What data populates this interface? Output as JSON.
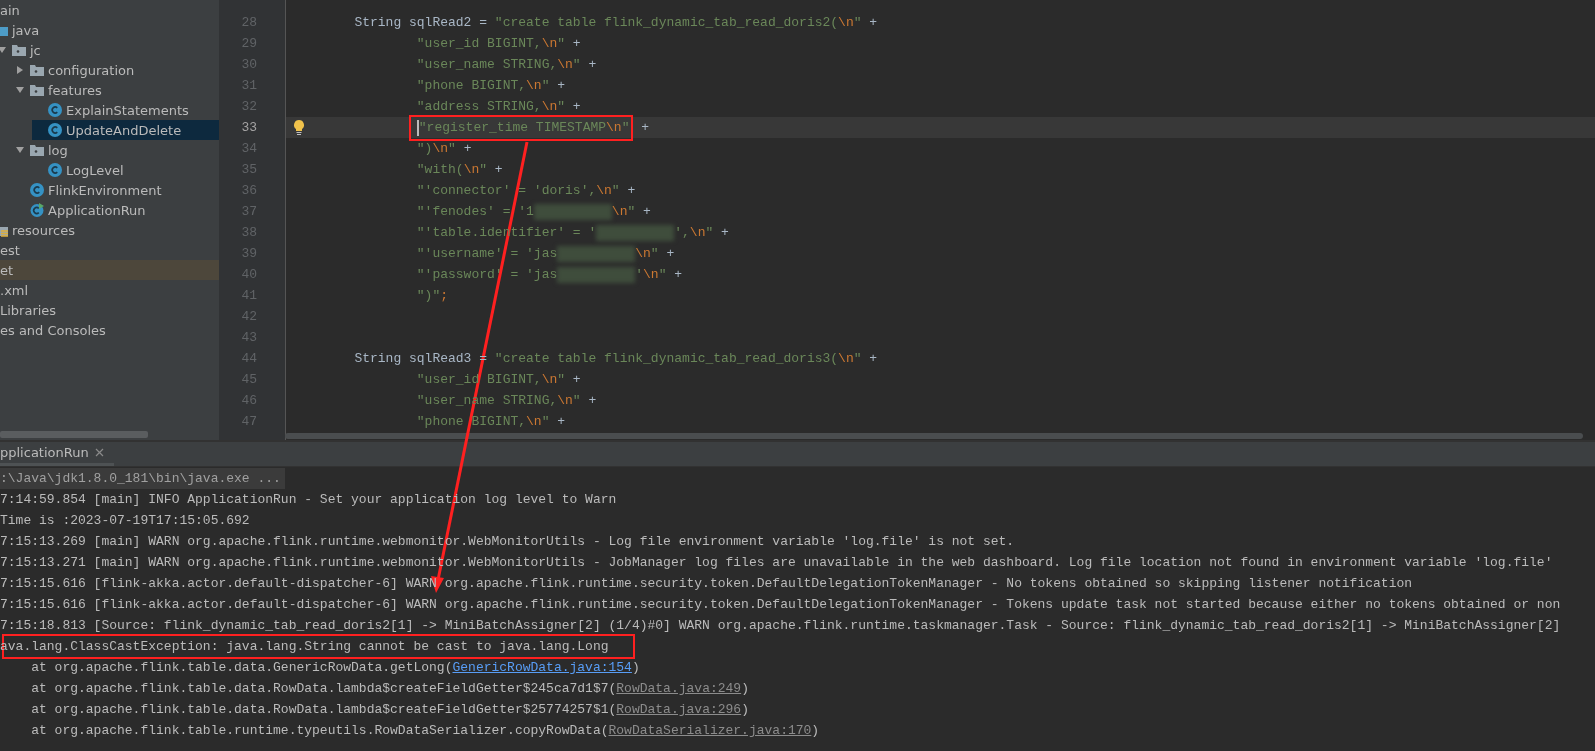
{
  "project_tree": {
    "items": [
      {
        "label": "ain",
        "children": [
          {
            "label": "java",
            "kind": "source-folder",
            "children": [
              {
                "label": "jc",
                "kind": "package",
                "expanded": true,
                "children": [
                  {
                    "label": "configuration",
                    "kind": "package",
                    "expanded": false
                  },
                  {
                    "label": "features",
                    "kind": "package",
                    "expanded": true,
                    "children": [
                      {
                        "label": "ExplainStatements",
                        "kind": "class",
                        "selected": false
                      },
                      {
                        "label": "UpdateAndDelete",
                        "kind": "class",
                        "selected": true
                      }
                    ]
                  },
                  {
                    "label": "log",
                    "kind": "package",
                    "expanded": true,
                    "children": [
                      {
                        "label": "LogLevel",
                        "kind": "class",
                        "selected": false
                      }
                    ]
                  },
                  {
                    "label": "FlinkEnvironment",
                    "kind": "class",
                    "selected": false
                  },
                  {
                    "label": "ApplicationRun",
                    "kind": "main-class",
                    "selected": false
                  }
                ]
              }
            ]
          },
          {
            "label": "resources",
            "kind": "resources-folder"
          }
        ]
      },
      {
        "label": "est"
      },
      {
        "label": "et",
        "excluded": true
      },
      {
        "label": ".xml"
      },
      {
        "label": "Libraries"
      },
      {
        "label": "es and Consoles"
      }
    ]
  },
  "editor": {
    "lines": [
      {
        "number": "28",
        "kind": "statement",
        "tokens": [
          {
            "kind": "plain",
            "text": "String sqlRead2 = "
          },
          {
            "kind": "str",
            "text": "\"create table flink_dynamic_tab_read_doris2("
          },
          {
            "kind": "esc",
            "text": "\\n"
          },
          {
            "kind": "str",
            "text": "\""
          },
          {
            "kind": "plain",
            "text": " +"
          }
        ]
      },
      {
        "number": "29",
        "kind": "continuation",
        "tokens": [
          {
            "kind": "str",
            "text": "\"user_id BIGINT,"
          },
          {
            "kind": "esc",
            "text": "\\n"
          },
          {
            "kind": "str",
            "text": "\""
          },
          {
            "kind": "plain",
            "text": " +"
          }
        ]
      },
      {
        "number": "30",
        "kind": "continuation",
        "tokens": [
          {
            "kind": "str",
            "text": "\"user_name STRING,"
          },
          {
            "kind": "esc",
            "text": "\\n"
          },
          {
            "kind": "str",
            "text": "\""
          },
          {
            "kind": "plain",
            "text": " +"
          }
        ]
      },
      {
        "number": "31",
        "kind": "continuation",
        "tokens": [
          {
            "kind": "str",
            "text": "\"phone BIGINT,"
          },
          {
            "kind": "esc",
            "text": "\\n"
          },
          {
            "kind": "str",
            "text": "\""
          },
          {
            "kind": "plain",
            "text": " +"
          }
        ]
      },
      {
        "number": "32",
        "kind": "continuation",
        "tokens": [
          {
            "kind": "str",
            "text": "\"address STRING,"
          },
          {
            "kind": "esc",
            "text": "\\n"
          },
          {
            "kind": "str",
            "text": "\""
          },
          {
            "kind": "plain",
            "text": " +"
          }
        ]
      },
      {
        "number": "33",
        "kind": "continuation",
        "current": true,
        "bulb": true,
        "caret": true,
        "tokens": [
          {
            "kind": "str",
            "text": "\"register_time TIMESTAMP",
            "boxed": true
          },
          {
            "kind": "esc",
            "text": "\\n",
            "boxed": true
          },
          {
            "kind": "str",
            "text": "\"",
            "boxed": true
          },
          {
            "kind": "plain",
            "text": " +"
          }
        ]
      },
      {
        "number": "34",
        "kind": "continuation",
        "tokens": [
          {
            "kind": "str",
            "text": "\")"
          },
          {
            "kind": "esc",
            "text": "\\n"
          },
          {
            "kind": "str",
            "text": "\""
          },
          {
            "kind": "plain",
            "text": " +"
          }
        ]
      },
      {
        "number": "35",
        "kind": "continuation",
        "tokens": [
          {
            "kind": "str",
            "text": "\"with("
          },
          {
            "kind": "esc",
            "text": "\\n"
          },
          {
            "kind": "str",
            "text": "\""
          },
          {
            "kind": "plain",
            "text": " +"
          }
        ]
      },
      {
        "number": "36",
        "kind": "continuation",
        "tokens": [
          {
            "kind": "str",
            "text": "\"'connector' = 'doris',"
          },
          {
            "kind": "esc",
            "text": "\\n"
          },
          {
            "kind": "str",
            "text": "\""
          },
          {
            "kind": "plain",
            "text": " +"
          }
        ]
      },
      {
        "number": "37",
        "kind": "continuation",
        "tokens": [
          {
            "kind": "str",
            "text": "\"'fenodes' = '1"
          },
          {
            "kind": "blur"
          },
          {
            "kind": "esc",
            "text": "\\n"
          },
          {
            "kind": "str",
            "text": "\""
          },
          {
            "kind": "plain",
            "text": " +"
          }
        ]
      },
      {
        "number": "38",
        "kind": "continuation",
        "tokens": [
          {
            "kind": "str",
            "text": "\"'table.identifier' = '"
          },
          {
            "kind": "blur"
          },
          {
            "kind": "str",
            "text": "',"
          },
          {
            "kind": "esc",
            "text": "\\n"
          },
          {
            "kind": "str",
            "text": "\""
          },
          {
            "kind": "plain",
            "text": " +"
          }
        ]
      },
      {
        "number": "39",
        "kind": "continuation",
        "tokens": [
          {
            "kind": "str",
            "text": "\"'username' = 'jas"
          },
          {
            "kind": "blur"
          },
          {
            "kind": "esc",
            "text": "\\n"
          },
          {
            "kind": "str",
            "text": "\""
          },
          {
            "kind": "plain",
            "text": " +"
          }
        ]
      },
      {
        "number": "40",
        "kind": "continuation",
        "tokens": [
          {
            "kind": "str",
            "text": "\"'password' = 'jas"
          },
          {
            "kind": "blur"
          },
          {
            "kind": "str",
            "text": "'"
          },
          {
            "kind": "esc",
            "text": "\\n"
          },
          {
            "kind": "str",
            "text": "\""
          },
          {
            "kind": "plain",
            "text": " +"
          }
        ]
      },
      {
        "number": "41",
        "kind": "continuation",
        "tokens": [
          {
            "kind": "str",
            "text": "\")\""
          },
          {
            "kind": "esc",
            "text": ";"
          }
        ]
      },
      {
        "number": "42"
      },
      {
        "number": "43"
      },
      {
        "number": "44",
        "kind": "statement",
        "tokens": [
          {
            "kind": "plain",
            "text": "String sqlRead3 = "
          },
          {
            "kind": "str",
            "text": "\"create table flink_dynamic_tab_read_doris3("
          },
          {
            "kind": "esc",
            "text": "\\n"
          },
          {
            "kind": "str",
            "text": "\""
          },
          {
            "kind": "plain",
            "text": " +"
          }
        ]
      },
      {
        "number": "45",
        "kind": "continuation",
        "tokens": [
          {
            "kind": "str",
            "text": "\"user_id BIGINT,"
          },
          {
            "kind": "esc",
            "text": "\\n"
          },
          {
            "kind": "str",
            "text": "\""
          },
          {
            "kind": "plain",
            "text": " +"
          }
        ]
      },
      {
        "number": "46",
        "kind": "continuation",
        "tokens": [
          {
            "kind": "str",
            "text": "\"user_name STRING,"
          },
          {
            "kind": "esc",
            "text": "\\n"
          },
          {
            "kind": "str",
            "text": "\""
          },
          {
            "kind": "plain",
            "text": " +"
          }
        ]
      },
      {
        "number": "47",
        "kind": "continuation",
        "tokens": [
          {
            "kind": "str",
            "text": "\"phone BIGINT,"
          },
          {
            "kind": "esc",
            "text": "\\n"
          },
          {
            "kind": "str",
            "text": "\""
          },
          {
            "kind": "plain",
            "text": " +"
          }
        ]
      }
    ]
  },
  "run_panel": {
    "tabs": [
      {
        "label": "pplicationRun",
        "selected": true
      }
    ],
    "lines": [
      {
        "kind": "command",
        "tokens": [
          {
            "kind": "text",
            "text": ":\\Java\\jdk1.8.0_181\\bin\\java.exe ..."
          }
        ]
      },
      {
        "kind": "log",
        "tokens": [
          {
            "kind": "text",
            "text": "7:14:59.854 [main] INFO ApplicationRun - Set your application log level to Warn"
          }
        ]
      },
      {
        "kind": "log",
        "tokens": [
          {
            "kind": "text",
            "text": "Time is :2023-07-19T17:15:05.692"
          }
        ]
      },
      {
        "kind": "log",
        "tokens": [
          {
            "kind": "text",
            "text": "7:15:13.269 [main] WARN org.apache.flink.runtime.webmonitor.WebMonitorUtils - Log file environment variable 'log.file' is not set."
          }
        ]
      },
      {
        "kind": "log",
        "tokens": [
          {
            "kind": "text",
            "text": "7:15:13.271 [main] WARN org.apache.flink.runtime.webmonitor.WebMonitorUtils - JobManager log files are unavailable in the web dashboard. Log file location not found in environment variable 'log.file'"
          }
        ]
      },
      {
        "kind": "log",
        "tokens": [
          {
            "kind": "text",
            "text": "7:15:15.616 [flink-akka.actor.default-dispatcher-6] WARN org.apache.flink.runtime.security.token.DefaultDelegationTokenManager - No tokens obtained so skipping listener notification"
          }
        ]
      },
      {
        "kind": "log",
        "tokens": [
          {
            "kind": "text",
            "text": "7:15:15.616 [flink-akka.actor.default-dispatcher-6] WARN org.apache.flink.runtime.security.token.DefaultDelegationTokenManager - Tokens update task not started because either no tokens obtained or non"
          }
        ]
      },
      {
        "kind": "log",
        "tokens": [
          {
            "kind": "text",
            "text": "7:15:18.813 [Source: flink_dynamic_tab_read_doris2[1] -> MiniBatchAssigner[2] (1/4)#0] WARN org.apache.flink.runtime.taskmanager.Task - Source: flink_dynamic_tab_read_doris2[1] -> MiniBatchAssigner[2]"
          }
        ]
      },
      {
        "kind": "error",
        "boxed": true,
        "tokens": [
          {
            "kind": "text",
            "text": "ava.lang.ClassCastException: java.lang.String cannot be cast to java.lang.Long"
          }
        ]
      },
      {
        "kind": "trace",
        "tokens": [
          {
            "kind": "text",
            "text": "    at org.apache.flink.table.data.GenericRowData.getLong("
          },
          {
            "kind": "link",
            "text": "GenericRowData.java:154"
          },
          {
            "kind": "text",
            "text": ")"
          }
        ]
      },
      {
        "kind": "trace",
        "tokens": [
          {
            "kind": "text",
            "text": "    at org.apache.flink.table.data.RowData.lambda$createFieldGetter$245ca7d1$7("
          },
          {
            "kind": "lib-link",
            "text": "RowData.java:249"
          },
          {
            "kind": "text",
            "text": ")"
          }
        ]
      },
      {
        "kind": "trace",
        "tokens": [
          {
            "kind": "text",
            "text": "    at org.apache.flink.table.data.RowData.lambda$createFieldGetter$25774257$1("
          },
          {
            "kind": "lib-link",
            "text": "RowData.java:296"
          },
          {
            "kind": "text",
            "text": ")"
          }
        ]
      },
      {
        "kind": "trace",
        "tokens": [
          {
            "kind": "text",
            "text": "    at org.apache.flink.table.runtime.typeutils.RowDataSerializer.copyRowData("
          },
          {
            "kind": "lib-link",
            "text": "RowDataSerializer.java:170"
          },
          {
            "kind": "text",
            "text": ")"
          }
        ]
      }
    ]
  },
  "annotations": [
    {
      "kind": "arrow"
    }
  ]
}
